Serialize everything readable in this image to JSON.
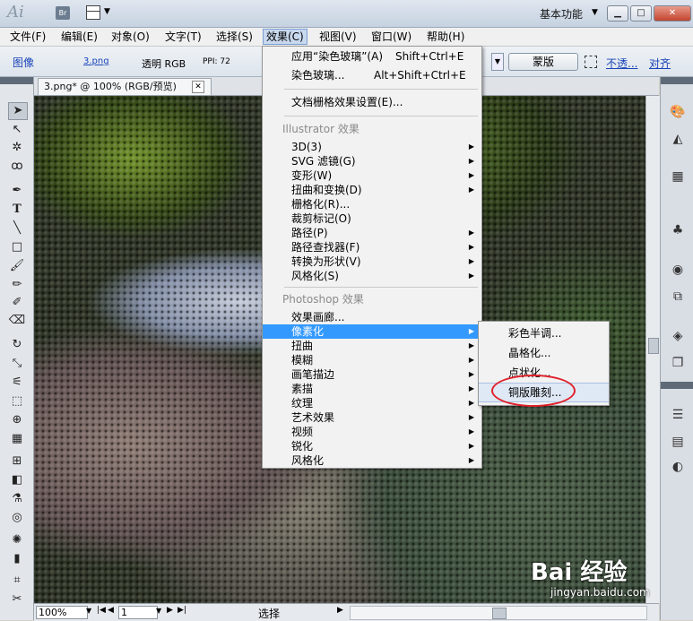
{
  "titlebar": {
    "app_logo": "Ai",
    "bridge_label": "Br",
    "workspace": "基本功能",
    "minimize": "▁",
    "maximize": "□",
    "close": "✕"
  },
  "menubar": {
    "items": [
      "文件(F)",
      "编辑(E)",
      "对象(O)",
      "文字(T)",
      "选择(S)",
      "效果(C)",
      "视图(V)",
      "窗口(W)",
      "帮助(H)"
    ]
  },
  "controlbar": {
    "image_label": "图像",
    "file_link": "3.png",
    "transparency": "透明 RGB",
    "ppi": "PPI: 72",
    "mask_button": "蒙版",
    "opacity_link": "不透...",
    "align_link": "对齐"
  },
  "document": {
    "tab_title": "3.png* @ 100% (RGB/预览)",
    "tab_close": "✕"
  },
  "effect_menu": {
    "apply_last": "应用“染色玻璃”(A)",
    "apply_last_shortcut": "Shift+Ctrl+E",
    "last_effect": "染色玻璃...",
    "last_effect_shortcut": "Alt+Shift+Ctrl+E",
    "raster_settings": "文档栅格效果设置(E)...",
    "illustrator_header": "Illustrator 效果",
    "illustrator_items": [
      "3D(3)",
      "SVG 滤镜(G)",
      "变形(W)",
      "扭曲和变换(D)",
      "栅格化(R)...",
      "裁剪标记(O)",
      "路径(P)",
      "路径查找器(F)",
      "转换为形状(V)",
      "风格化(S)"
    ],
    "photoshop_header": "Photoshop 效果",
    "photoshop_items": [
      "效果画廊...",
      "像素化",
      "扭曲",
      "模糊",
      "画笔描边",
      "素描",
      "纹理",
      "艺术效果",
      "视频",
      "锐化",
      "风格化"
    ]
  },
  "pixelate_submenu": {
    "items": [
      "彩色半调...",
      "晶格化...",
      "点状化...",
      "铜版雕刻..."
    ]
  },
  "statusbar": {
    "zoom": "100%",
    "page": "1",
    "status": "选择"
  },
  "watermark": {
    "brand": "Bai 经验",
    "url": "jingyan.baidu.com"
  }
}
